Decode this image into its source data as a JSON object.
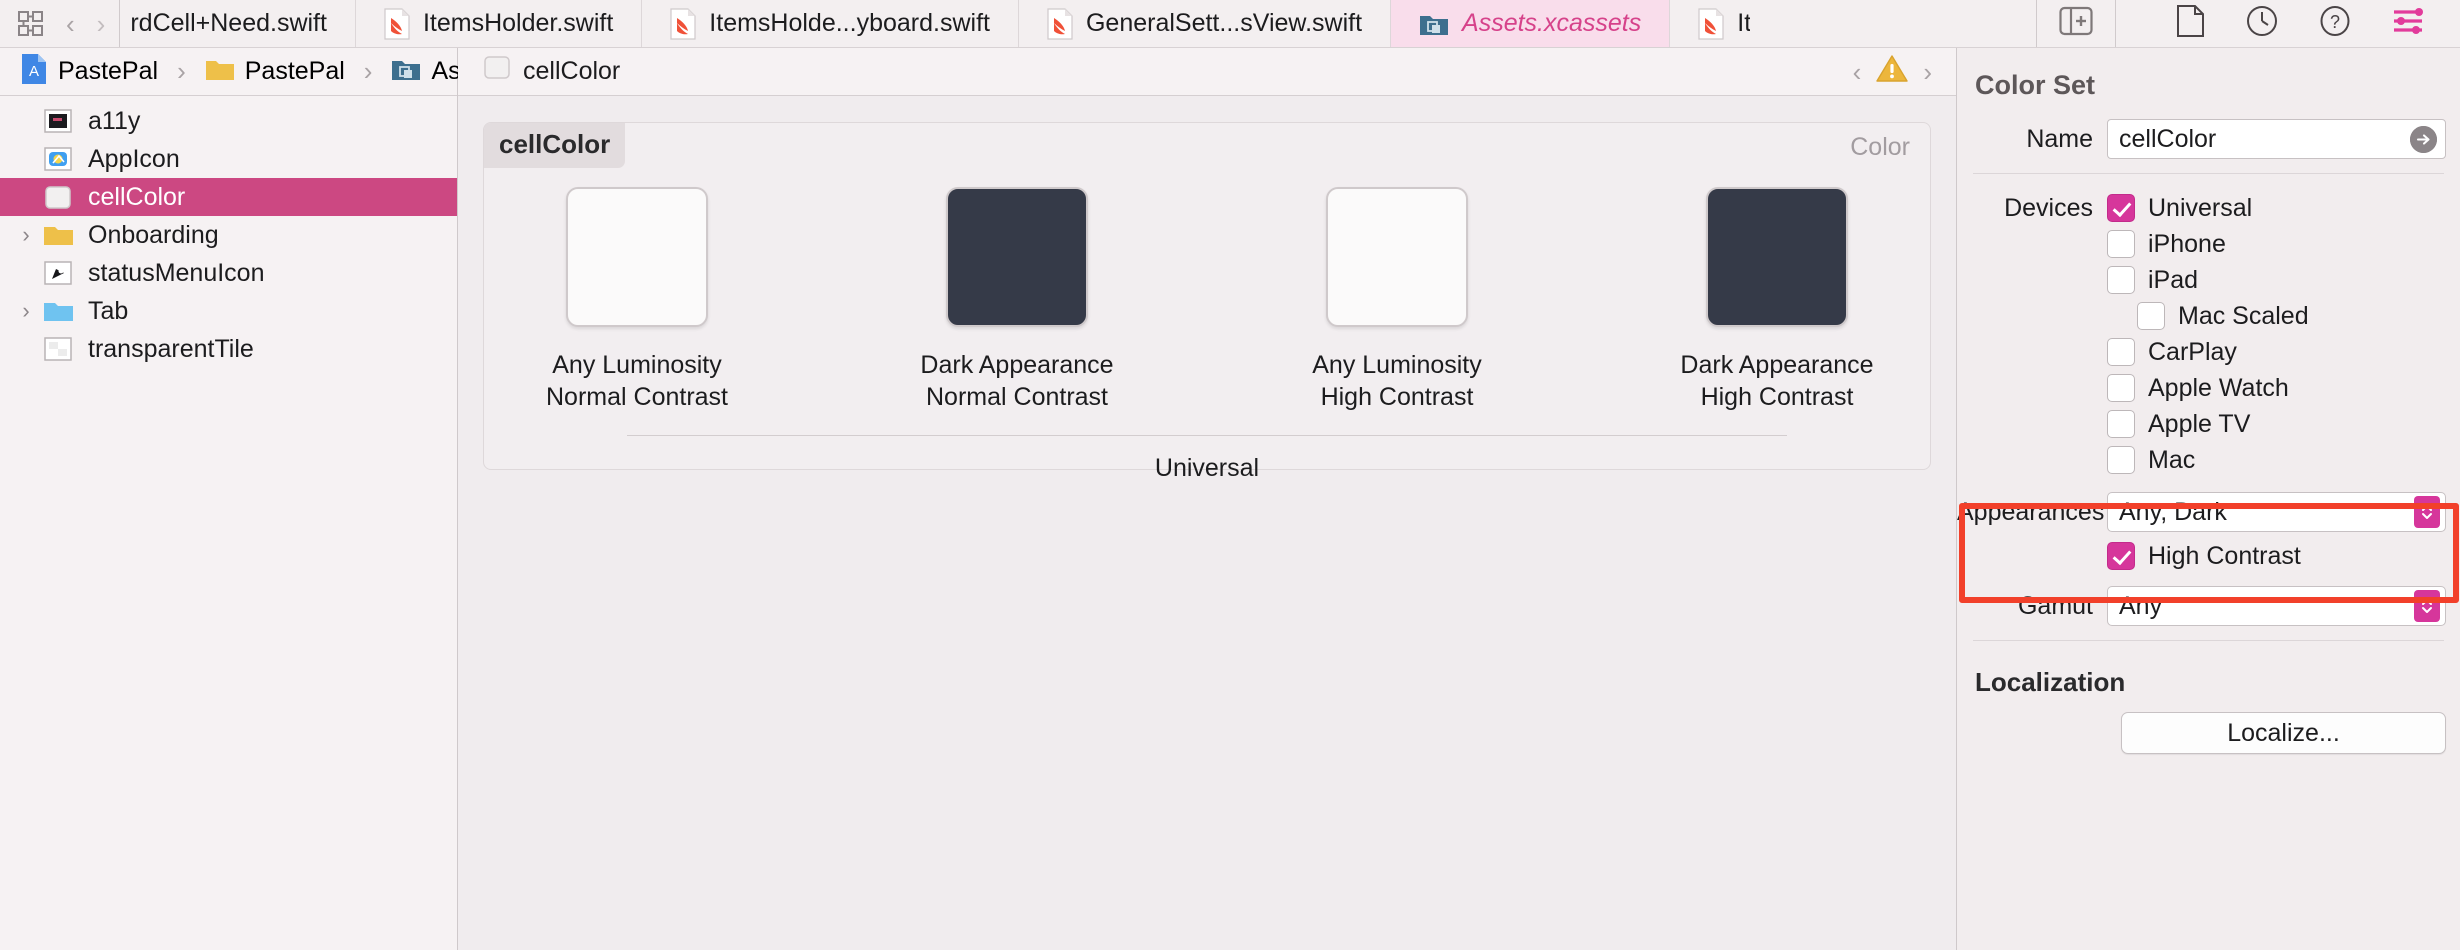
{
  "toolbar": {
    "grid_icon": "grid-icon",
    "back_label": "‹",
    "forward_label": "›",
    "add_editor_icon": "add-editor-icon",
    "inspector_icons": [
      {
        "name": "file-inspector-icon",
        "glyph": "file"
      },
      {
        "name": "history-inspector-icon",
        "glyph": "clock"
      },
      {
        "name": "quick-help-inspector-icon",
        "glyph": "question"
      },
      {
        "name": "attributes-inspector-icon",
        "glyph": "sliders"
      }
    ]
  },
  "tabs": [
    {
      "label": "rdCell+Need.swift",
      "icon": "swift-file-icon",
      "active": false,
      "clipped_left": true
    },
    {
      "label": "ItemsHolder.swift",
      "icon": "swift-file-icon",
      "active": false
    },
    {
      "label": "ItemsHolde...yboard.swift",
      "icon": "swift-file-icon",
      "active": false
    },
    {
      "label": "GeneralSett...sView.swift",
      "icon": "swift-file-icon",
      "active": false
    },
    {
      "label": "Assets.xcassets",
      "icon": "assets-folder-icon",
      "active": true
    },
    {
      "label": "Ite",
      "icon": "swift-file-icon",
      "active": false,
      "clipped": true
    }
  ],
  "navigator": {
    "items": [
      {
        "label": "a11y",
        "icon": "imageset-icon",
        "disclosure": false,
        "selected": false
      },
      {
        "label": "AppIcon",
        "icon": "appicon-icon",
        "disclosure": false,
        "selected": false
      },
      {
        "label": "cellColor",
        "icon": "colorset-icon",
        "disclosure": false,
        "selected": true
      },
      {
        "label": "Onboarding",
        "icon": "yellow-folder-icon",
        "disclosure": true,
        "selected": false
      },
      {
        "label": "statusMenuIcon",
        "icon": "imageset-icon",
        "disclosure": false,
        "selected": false
      },
      {
        "label": "Tab",
        "icon": "blue-folder-icon",
        "disclosure": true,
        "selected": false
      },
      {
        "label": "transparentTile",
        "icon": "transparent-tile-icon",
        "disclosure": false,
        "selected": false
      }
    ]
  },
  "breadcrumb": {
    "items": [
      {
        "label": "PastePal",
        "icon": "xcode-project-icon"
      },
      {
        "label": "PastePal",
        "icon": "yellow-folder-icon"
      },
      {
        "label": "Assets.xcassets",
        "icon": "assets-folder-icon"
      },
      {
        "label": "cellColor",
        "icon": "colorset-icon"
      }
    ],
    "separator": "›",
    "issue_prev": "‹",
    "issue_next": "›",
    "issue_badge": "warning-triangle-icon"
  },
  "editor": {
    "card_title": "cellColor",
    "card_kind": "Color",
    "swatches": [
      {
        "label_line1": "Any Luminosity",
        "label_line2": "Normal Contrast",
        "color": "#fbfafa",
        "is_dark": false
      },
      {
        "label_line1": "Dark Appearance",
        "label_line2": "Normal Contrast",
        "color": "#353a48",
        "is_dark": true
      },
      {
        "label_line1": "Any Luminosity",
        "label_line2": "High Contrast",
        "color": "#fbfafa",
        "is_dark": false
      },
      {
        "label_line1": "Dark Appearance",
        "label_line2": "High Contrast",
        "color": "#353a48",
        "is_dark": true
      }
    ],
    "group_label": "Universal"
  },
  "inspector": {
    "title": "Color Set",
    "name_label": "Name",
    "name_value": "cellColor",
    "devices_label": "Devices",
    "devices": [
      {
        "label": "Universal",
        "checked": true,
        "indent": false
      },
      {
        "label": "iPhone",
        "checked": false,
        "indent": false
      },
      {
        "label": "iPad",
        "checked": false,
        "indent": false
      },
      {
        "label": "Mac Scaled",
        "checked": false,
        "indent": true
      },
      {
        "label": "CarPlay",
        "checked": false,
        "indent": false
      },
      {
        "label": "Apple Watch",
        "checked": false,
        "indent": false
      },
      {
        "label": "Apple TV",
        "checked": false,
        "indent": false
      },
      {
        "label": "Mac",
        "checked": false,
        "indent": false
      }
    ],
    "appearances_label": "Appearances",
    "appearances_value": "Any, Dark",
    "high_contrast_label": "High Contrast",
    "high_contrast_checked": true,
    "gamut_label": "Gamut",
    "gamut_value": "Any",
    "localization_label": "Localization",
    "localize_button": "Localize..."
  },
  "colors": {
    "accent_pink": "#d6369b",
    "selection_pink": "#cc4882",
    "tab_active_bg": "#f9ddeb",
    "tab_active_text": "#d6428a",
    "dark_swatch": "#353a48",
    "highlight_red": "#f2402a",
    "warning_yellow": "#ecb63c"
  }
}
